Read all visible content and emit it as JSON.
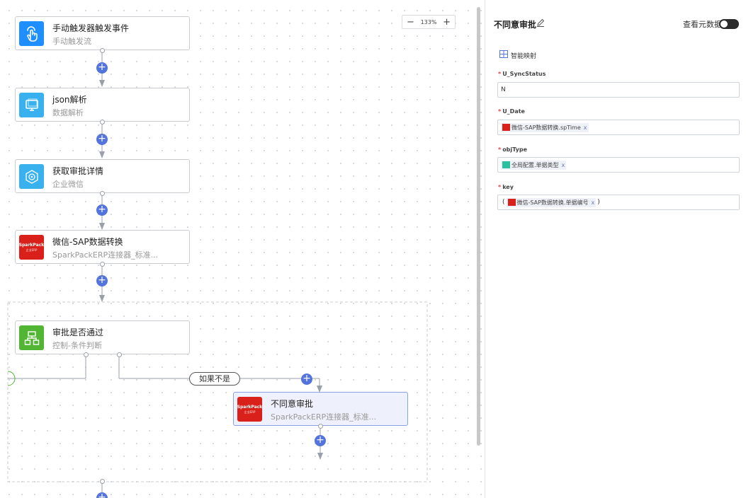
{
  "canvas": {
    "zoom": {
      "minus": "−",
      "value": "133%",
      "plus": "+"
    },
    "nodes": [
      {
        "title": "手动触发器触发事件",
        "subtitle": "手动触发流",
        "icon": "hand-pointer-icon"
      },
      {
        "title": "json解析",
        "subtitle": "数据解析",
        "icon": "monitor-icon"
      },
      {
        "title": "获取审批详情",
        "subtitle": "企业微信",
        "icon": "wecom-icon"
      },
      {
        "title": "微信-SAP数据转换",
        "subtitle": "SparkPackERP连接器_标准...",
        "icon": "sparkpack-logo"
      },
      {
        "title": "审批是否通过",
        "subtitle": "控制-条件判断",
        "icon": "flowchart-icon"
      },
      {
        "title": "不同意审批",
        "subtitle": "SparkPackERP连接器_标准...",
        "icon": "sparkpack-logo"
      }
    ],
    "logo": {
      "line1": "SparkPack",
      "line2": "企业ERP"
    },
    "branch_label": "如果不是",
    "add_symbol": "+"
  },
  "panel": {
    "title": "不同意审批",
    "meta_label": "查看元数据",
    "meta_toggle_on": false,
    "smart_map_label": "智能映射",
    "required_mark": "*",
    "fields": [
      {
        "label": "U_SyncStatus",
        "required": true,
        "value": "N"
      },
      {
        "label": "U_Date",
        "required": true,
        "token": "微信-SAP数据转换.spTime",
        "token_color": "#d9201a"
      },
      {
        "label": "objType",
        "required": true,
        "token": "全局配置.单据类型",
        "token_color": "#29c0a0"
      },
      {
        "label": "key",
        "required": true,
        "prefix": "(",
        "token": "微信-SAP数据转换.单据编号",
        "suffix": ")",
        "token_color": "#d9201a"
      }
    ],
    "token_close": "x"
  },
  "colors": {
    "accent": "#5374dd",
    "selected_bg": "#eef1fb",
    "required": "#e0453a"
  }
}
